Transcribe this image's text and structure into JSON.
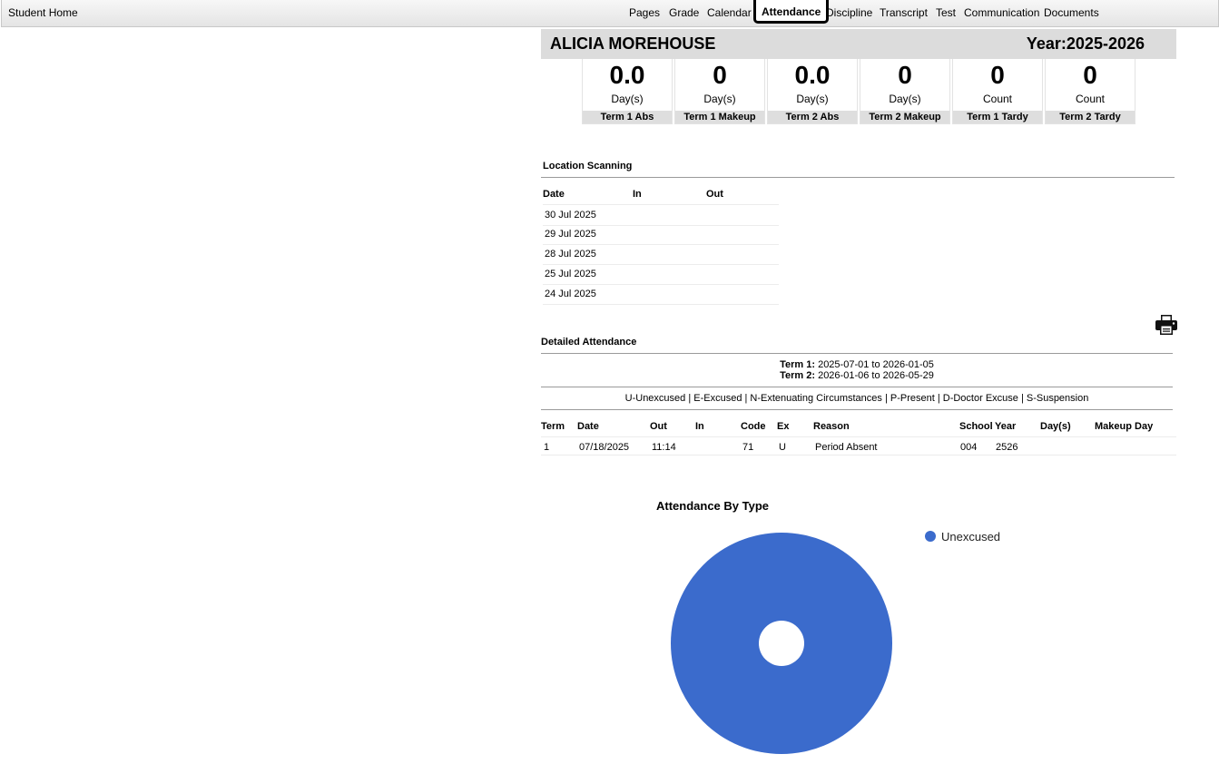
{
  "topbar": {
    "home_label": "Student Home",
    "nav": [
      {
        "label": "Pages"
      },
      {
        "label": "Grade"
      },
      {
        "label": "Calendar"
      },
      {
        "label": "Attendance",
        "active": true
      },
      {
        "label": "Discipline"
      },
      {
        "label": "Transcript"
      },
      {
        "label": "Test"
      },
      {
        "label": "Communication"
      },
      {
        "label": "Documents"
      }
    ]
  },
  "student": {
    "name": "ALICIA MOREHOUSE",
    "year": "Year:2025-2026"
  },
  "summary": [
    {
      "value": "0.0",
      "unit": "Day(s)",
      "label": "Term 1 Abs"
    },
    {
      "value": "0",
      "unit": "Day(s)",
      "label": "Term 1 Makeup"
    },
    {
      "value": "0.0",
      "unit": "Day(s)",
      "label": "Term 2 Abs"
    },
    {
      "value": "0",
      "unit": "Day(s)",
      "label": "Term 2 Makeup"
    },
    {
      "value": "0",
      "unit": "Count",
      "label": "Term 1 Tardy"
    },
    {
      "value": "0",
      "unit": "Count",
      "label": "Term 2 Tardy"
    }
  ],
  "location_scanning": {
    "title": "Location Scanning",
    "headers": {
      "date": "Date",
      "in": "In",
      "out": "Out"
    },
    "rows": [
      "30 Jul 2025",
      "29 Jul 2025",
      "28 Jul 2025",
      "25 Jul 2025",
      "24 Jul 2025"
    ]
  },
  "detailed": {
    "title": "Detailed Attendance",
    "term1_label": "Term 1:",
    "term1_range": " 2025-07-01 to 2026-01-05",
    "term2_label": "Term 2:",
    "term2_range": " 2026-01-06 to 2026-05-29",
    "codes_legend": "U-Unexcused | E-Excused | N-Extenuating Circumstances | P-Present | D-Doctor Excuse | S-Suspension",
    "headers": {
      "term": "Term",
      "date": "Date",
      "out": "Out",
      "in": "In",
      "code": "Code",
      "ex": "Ex",
      "reason": "Reason",
      "school": "School",
      "year": "Year",
      "days": "Day(s)",
      "makeup": "Makeup Day"
    },
    "row": {
      "term": "1",
      "date": "07/18/2025",
      "out": "11:14",
      "in": "",
      "code": "71",
      "ex": "U",
      "reason": "Period Absent",
      "school": "004",
      "year": "2526",
      "days": "",
      "makeup": ""
    }
  },
  "chart_data": {
    "type": "pie",
    "title": "Attendance By Type",
    "categories": [
      "Unexcused"
    ],
    "values": [
      1
    ],
    "colors": [
      "#3b6bcc"
    ],
    "legend": "right"
  }
}
